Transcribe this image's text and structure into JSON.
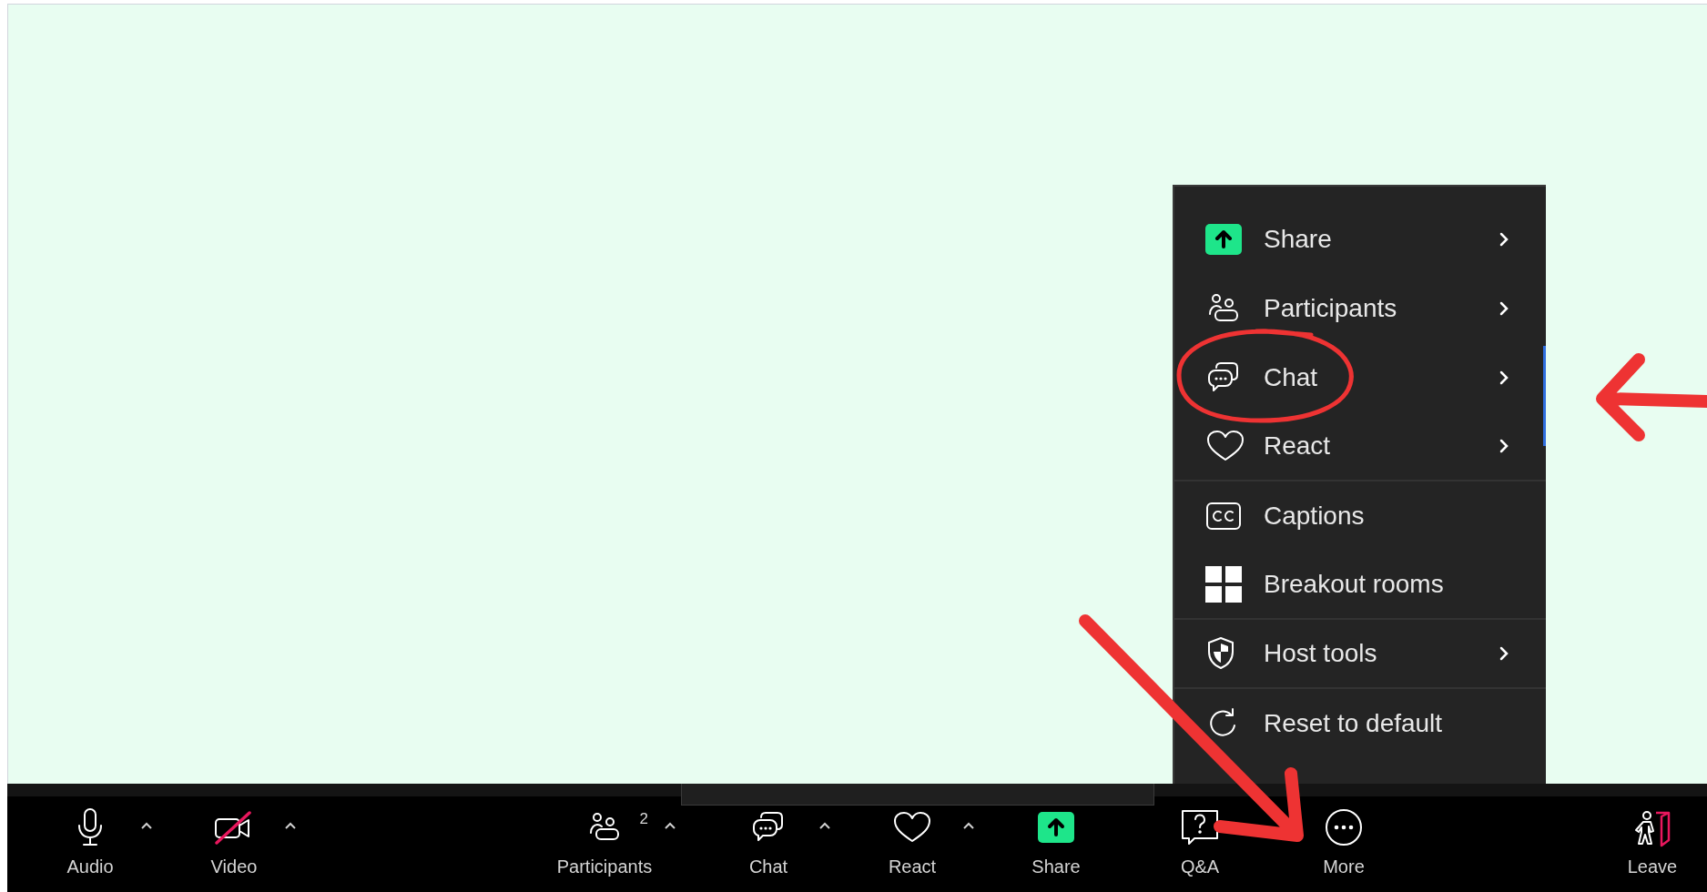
{
  "more_menu": {
    "items": [
      {
        "kind": "share",
        "label": "Share",
        "submenu": true,
        "divider_after": false
      },
      {
        "kind": "participants",
        "label": "Participants",
        "submenu": true,
        "divider_after": false
      },
      {
        "kind": "chat",
        "label": "Chat",
        "submenu": true,
        "divider_after": false
      },
      {
        "kind": "react",
        "label": "React",
        "submenu": true,
        "divider_after": true
      },
      {
        "kind": "captions",
        "label": "Captions",
        "submenu": false,
        "divider_after": false
      },
      {
        "kind": "breakout",
        "label": "Breakout rooms",
        "submenu": false,
        "divider_after": true
      },
      {
        "kind": "host",
        "label": "Host tools",
        "submenu": true,
        "divider_after": true
      },
      {
        "kind": "reset",
        "label": "Reset to default",
        "submenu": false,
        "divider_after": false
      }
    ]
  },
  "toolbar": {
    "left": [
      {
        "kind": "audio",
        "label": "Audio",
        "caret": true
      },
      {
        "kind": "video",
        "label": "Video",
        "caret": true
      }
    ],
    "center": [
      {
        "kind": "participants",
        "label": "Participants",
        "badge": "2",
        "caret": true
      },
      {
        "kind": "chat",
        "label": "Chat",
        "caret": true
      },
      {
        "kind": "react",
        "label": "React",
        "caret": true
      },
      {
        "kind": "share",
        "label": "Share",
        "caret": false
      },
      {
        "kind": "qa",
        "label": "Q&A",
        "caret": false
      },
      {
        "kind": "more",
        "label": "More",
        "caret": false
      }
    ],
    "right": [
      {
        "kind": "leave",
        "label": "Leave",
        "caret": false
      }
    ]
  }
}
